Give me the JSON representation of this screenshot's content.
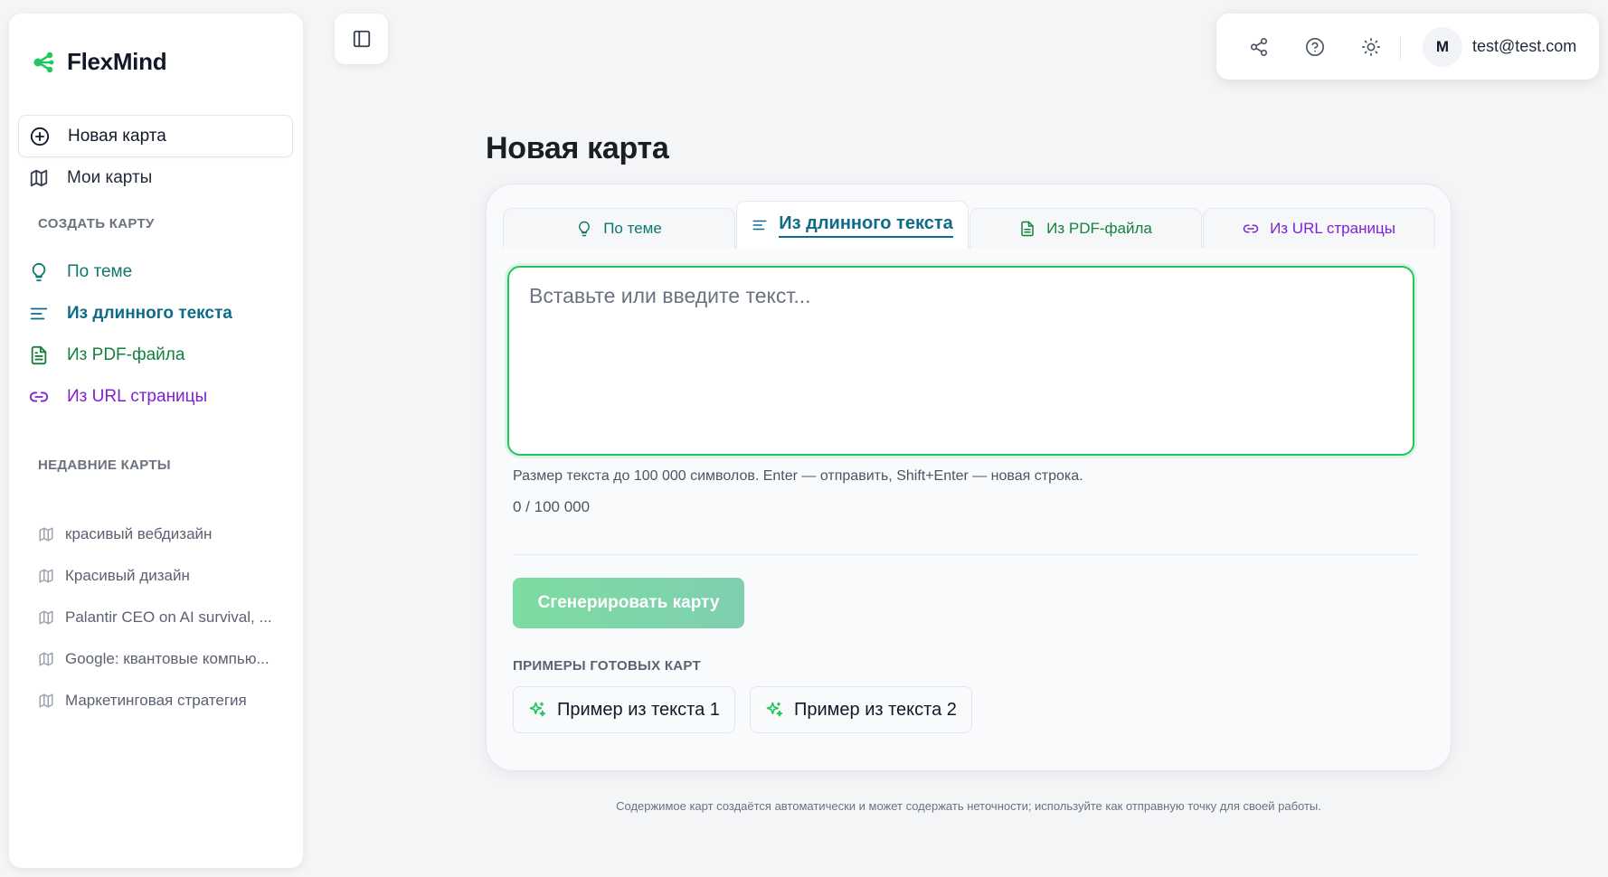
{
  "app": {
    "name": "FlexMind",
    "brand_color": "#22c55e"
  },
  "sidebar": {
    "main_nav": [
      {
        "label": "Новая карта",
        "icon": "plus-circle-icon",
        "active": true
      },
      {
        "label": "Мои карты",
        "icon": "map-icon",
        "active": false
      }
    ],
    "create_section_label": "СОЗДАТЬ КАРТУ",
    "create_items": [
      {
        "label": "По теме",
        "icon": "lightbulb-icon",
        "color": "#0f766e"
      },
      {
        "label": "Из длинного текста",
        "icon": "text-lines-icon",
        "color": "#0e6b8a"
      },
      {
        "label": "Из PDF-файла",
        "icon": "file-icon",
        "color": "#15803d"
      },
      {
        "label": "Из URL страницы",
        "icon": "link-icon",
        "color": "#7e22ce"
      }
    ],
    "recent_section_label": "НЕДАВНИЕ КАРТЫ",
    "recent_items": [
      {
        "label": "красивый вебдизайн"
      },
      {
        "label": "Красивый дизайн"
      },
      {
        "label": "Palantir CEO on AI survival, ..."
      },
      {
        "label": "Google: квантовые компью..."
      },
      {
        "label": "Маркетинговая стратегия"
      }
    ]
  },
  "topbar": {
    "icons": [
      "share-icon",
      "help-icon",
      "sun-icon"
    ],
    "avatar_initial": "M",
    "user_email": "test@test.com"
  },
  "main": {
    "title": "Новая карта",
    "tabs": [
      {
        "label": "По теме",
        "icon": "lightbulb-icon",
        "color": "#0f766e",
        "active": false
      },
      {
        "label": "Из длинного текста",
        "icon": "text-lines-icon",
        "color": "#0e6b8a",
        "active": true
      },
      {
        "label": "Из PDF-файла",
        "icon": "file-icon",
        "color": "#15803d",
        "active": false
      },
      {
        "label": "Из URL страницы",
        "icon": "link-icon",
        "color": "#7e22ce",
        "active": false
      }
    ],
    "textarea": {
      "placeholder": "Вставьте или введите текст...",
      "value": ""
    },
    "hint": "Размер текста до 100 000 символов. Enter — отправить, Shift+Enter — новая строка.",
    "counter": "0 / 100 000",
    "generate_label": "Сгенерировать карту",
    "examples_label": "ПРИМЕРЫ ГОТОВЫХ КАРТ",
    "examples": [
      {
        "label": "Пример из текста 1",
        "icon": "sparkles-icon"
      },
      {
        "label": "Пример из текста 2",
        "icon": "sparkles-icon"
      }
    ]
  },
  "footer_note": "Содержимое карт создаётся автоматически и может содержать неточности; используйте как отправную точку для своей работы."
}
